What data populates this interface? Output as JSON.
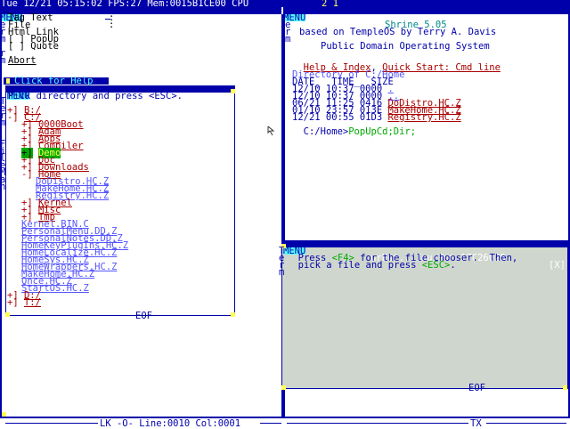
{
  "topbar": {
    "left": "Tue 12/21 05:15:02 FPS:27 Mem:0015B1CE00 CPU",
    "cpu_values": "2 1",
    "left_title": "MENU",
    "left_title2": "Z...~/Tmp.DD.Z...",
    "left_close": "[X]",
    "right_title": "MENU",
    "right_title2": "ir;;....PopUpCd 1694CA28",
    "right_close": "[X]"
  },
  "menu_popup": {
    "items": [
      "Tag Text",
      "File",
      "Html Link",
      "[ ] PopUp",
      "[ ] Quote",
      "",
      "Abort"
    ],
    "item_suffixes": [
      ":",
      ":",
      "",
      "",
      "",
      "",
      ""
    ],
    "click_help": "Click for Help"
  },
  "side_letters_left": [
    "T",
    "e",
    "r",
    "m",
    "",
    "",
    "F",
    "i",
    "l",
    "e",
    "M",
    "a",
    "n"
  ],
  "side_letters_left_top": [
    "e",
    "r",
    "m",
    "",
    "r",
    "m"
  ],
  "side_letters_right": [
    "T",
    "e",
    "r",
    "m"
  ],
  "filemgr": {
    "title_menu": "MENU",
    "title": "TerGr(FM_PICK_L1783",
    "close": "[X]",
    "prompt": "Pick directory and press <ESC>.",
    "tree": [
      {
        "indent": 0,
        "mark": "+]",
        "label": "B:/",
        "kind": "dir"
      },
      {
        "indent": 0,
        "mark": "-]",
        "label": "C:/",
        "kind": "dir"
      },
      {
        "indent": 2,
        "mark": "+]",
        "label": "0000Boot",
        "kind": "dir"
      },
      {
        "indent": 2,
        "mark": "+]",
        "label": "Adam",
        "kind": "dir"
      },
      {
        "indent": 2,
        "mark": "+]",
        "label": "Apps",
        "kind": "dir"
      },
      {
        "indent": 2,
        "mark": "+]",
        "label": "Compiler",
        "kind": "dir"
      },
      {
        "indent": 2,
        "mark": "+]",
        "label": "Demo",
        "kind": "selected"
      },
      {
        "indent": 2,
        "mark": "+]",
        "label": "Doc",
        "kind": "dir"
      },
      {
        "indent": 2,
        "mark": "+]",
        "label": "Downloads",
        "kind": "dir"
      },
      {
        "indent": 2,
        "mark": "-]",
        "label": "Home",
        "kind": "dir"
      },
      {
        "indent": 4,
        "mark": "",
        "label": "DoDistro.HC.Z",
        "kind": "file"
      },
      {
        "indent": 4,
        "mark": "",
        "label": "MakeHome.HC.Z",
        "kind": "file"
      },
      {
        "indent": 4,
        "mark": "",
        "label": "Registry.HC.Z",
        "kind": "file"
      },
      {
        "indent": 2,
        "mark": "+]",
        "label": "Kernel",
        "kind": "dir"
      },
      {
        "indent": 2,
        "mark": "+]",
        "label": "Misc",
        "kind": "dir"
      },
      {
        "indent": 2,
        "mark": "+]",
        "label": "Tmp",
        "kind": "dir"
      },
      {
        "indent": 2,
        "mark": "",
        "label": "Kernel.BIN.C",
        "kind": "file"
      },
      {
        "indent": 2,
        "mark": "",
        "label": "PersonalMenu.DD.Z",
        "kind": "file"
      },
      {
        "indent": 2,
        "mark": "",
        "label": "PersonalNotes.DD.Z",
        "kind": "file"
      },
      {
        "indent": 2,
        "mark": "",
        "label": "HomeKeyPlugIns.HC.Z",
        "kind": "file"
      },
      {
        "indent": 2,
        "mark": "",
        "label": "HomeLocalize.HC.Z",
        "kind": "file"
      },
      {
        "indent": 2,
        "mark": "",
        "label": "HomeSys.HC.Z",
        "kind": "file"
      },
      {
        "indent": 2,
        "mark": "",
        "label": "HomeWrappers.HC.Z",
        "kind": "file"
      },
      {
        "indent": 2,
        "mark": "",
        "label": "MakeHome.HC.Z",
        "kind": "file"
      },
      {
        "indent": 2,
        "mark": "",
        "label": "Once.HC.Z",
        "kind": "file"
      },
      {
        "indent": 2,
        "mark": "",
        "label": "StartOS.HC.Z",
        "kind": "file"
      },
      {
        "indent": 0,
        "mark": "+]",
        "label": "D:/",
        "kind": "dir"
      },
      {
        "indent": 0,
        "mark": "+]",
        "label": "T:/",
        "kind": "dir"
      }
    ],
    "eof": "EOF"
  },
  "shrine": {
    "title": "Shrine 5.05",
    "subtitle": "based on TempleOS by Terry A. Davis",
    "tagline": "Public Domain Operating System",
    "help_link": "Help & Index",
    "sep": ",",
    "quick_link": "Quick Start: Cmd line",
    "dir_header": "Directory of C:/Home",
    "columns": "DATE_  TIME_  SIZE",
    "rows": [
      {
        "date": "12/10",
        "time": "10:37",
        "size": "0000",
        "name": ".",
        "kind": "dot"
      },
      {
        "date": "12/10",
        "time": "10:37",
        "size": "0000",
        "name": "..",
        "kind": "dot"
      },
      {
        "date": "06/21",
        "time": "11:25",
        "size": "0416",
        "name": "DoDistro.HC.Z",
        "kind": "file"
      },
      {
        "date": "01/10",
        "time": "23:57",
        "size": "013E",
        "name": "MakeHome.HC.Z",
        "kind": "file"
      },
      {
        "date": "12/21",
        "time": "00:55",
        "size": "01D3",
        "name": "Registry.HC.Z",
        "kind": "file"
      }
    ],
    "prompt": "C:/Home>",
    "command": "PopUpCd;Dir;"
  },
  "popup2": {
    "title_menu": "MENU",
    "title": "urPut...TourPut 17C26028",
    "close": "[X]",
    "line1_pre": "Press ",
    "line1_key": "<F4>",
    "line1_post": " for the file chooser.  Then,",
    "line2_pre": "pick a file and press ",
    "line2_key": "<ESC>",
    "line2_post": ".",
    "eof": "EOF"
  },
  "statusbar": {
    "left": "LK -O- Line:0010 Col:0001",
    "right": "TX"
  },
  "colors": {
    "blue": "#0000aa",
    "yellow": "#ffff55",
    "red": "#aa0000",
    "gray_panel": "#cfd6cd"
  }
}
